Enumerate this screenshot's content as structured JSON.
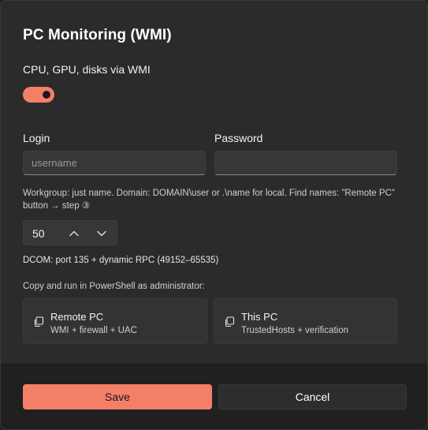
{
  "dialog": {
    "title": "PC Monitoring (WMI)"
  },
  "toggle": {
    "label": "CPU, GPU, disks via WMI",
    "state": "on",
    "accent_color": "#f47f67"
  },
  "login": {
    "label": "Login",
    "placeholder": "username",
    "value": ""
  },
  "password": {
    "label": "Password",
    "placeholder": "",
    "value": ""
  },
  "hint": "Workgroup: just name. Domain: DOMAIN\\user or .\\name for local. Find names: \"Remote PC\" button → step ③",
  "stepper": {
    "value": "50",
    "up_icon": "chevron-up-icon",
    "down_icon": "chevron-down-icon"
  },
  "dcom_note": "DCOM: port 135 + dynamic RPC (49152–65535)",
  "copy_hint": "Copy and run in PowerShell as administrator:",
  "scripts": [
    {
      "title": "Remote PC",
      "subtitle": "WMI + firewall + UAC",
      "icon": "copy-icon"
    },
    {
      "title": "This PC",
      "subtitle": "TrustedHosts + verification",
      "icon": "copy-icon"
    }
  ],
  "footer": {
    "save_label": "Save",
    "cancel_label": "Cancel"
  }
}
